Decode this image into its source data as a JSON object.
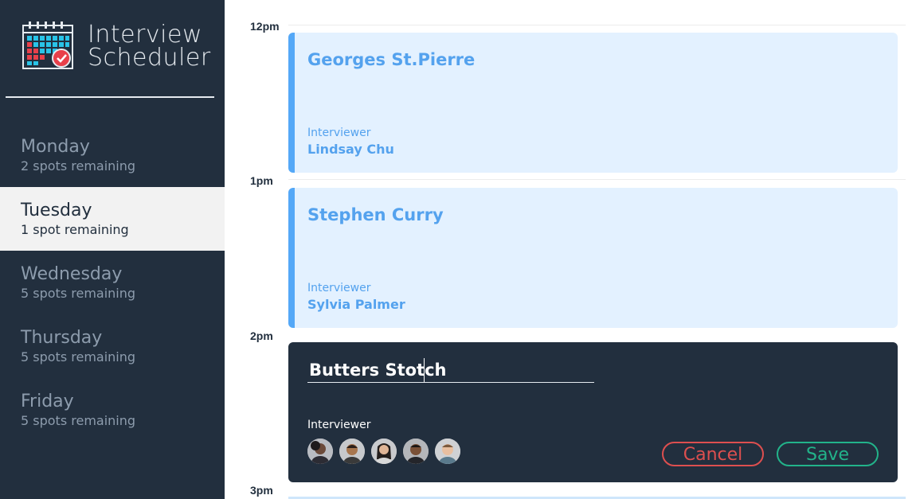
{
  "app": {
    "title_line1": "Interview",
    "title_line2": "Scheduler"
  },
  "days": [
    {
      "name": "Monday",
      "spots": "2 spots remaining"
    },
    {
      "name": "Tuesday",
      "spots": "1 spot remaining",
      "selected": true
    },
    {
      "name": "Wednesday",
      "spots": "5 spots remaining"
    },
    {
      "name": "Thursday",
      "spots": "5 spots remaining"
    },
    {
      "name": "Friday",
      "spots": "5 spots remaining"
    }
  ],
  "hours": [
    "12pm",
    "1pm",
    "2pm",
    "3pm"
  ],
  "appointments": [
    {
      "student": "Georges St.Pierre",
      "interviewer_label": "Interviewer",
      "interviewer": "Lindsay Chu"
    },
    {
      "student": "Stephen Curry",
      "interviewer_label": "Interviewer",
      "interviewer": "Sylvia Palmer"
    }
  ],
  "edit": {
    "student_value": "Butters Stotch",
    "interviewer_label": "Interviewer",
    "cancel_label": "Cancel",
    "save_label": "Save",
    "avatars": [
      "interviewer-avatar-1",
      "interviewer-avatar-2",
      "interviewer-avatar-3",
      "interviewer-avatar-4",
      "interviewer-avatar-5"
    ]
  },
  "colors": {
    "sidebar_bg": "#222f3e",
    "selected_day_bg": "#f2f2f2",
    "appointment_bg": "#e3f1ff",
    "appointment_accent": "#54a8f7",
    "cancel": "#dd4f4f",
    "save": "#22b38a"
  }
}
